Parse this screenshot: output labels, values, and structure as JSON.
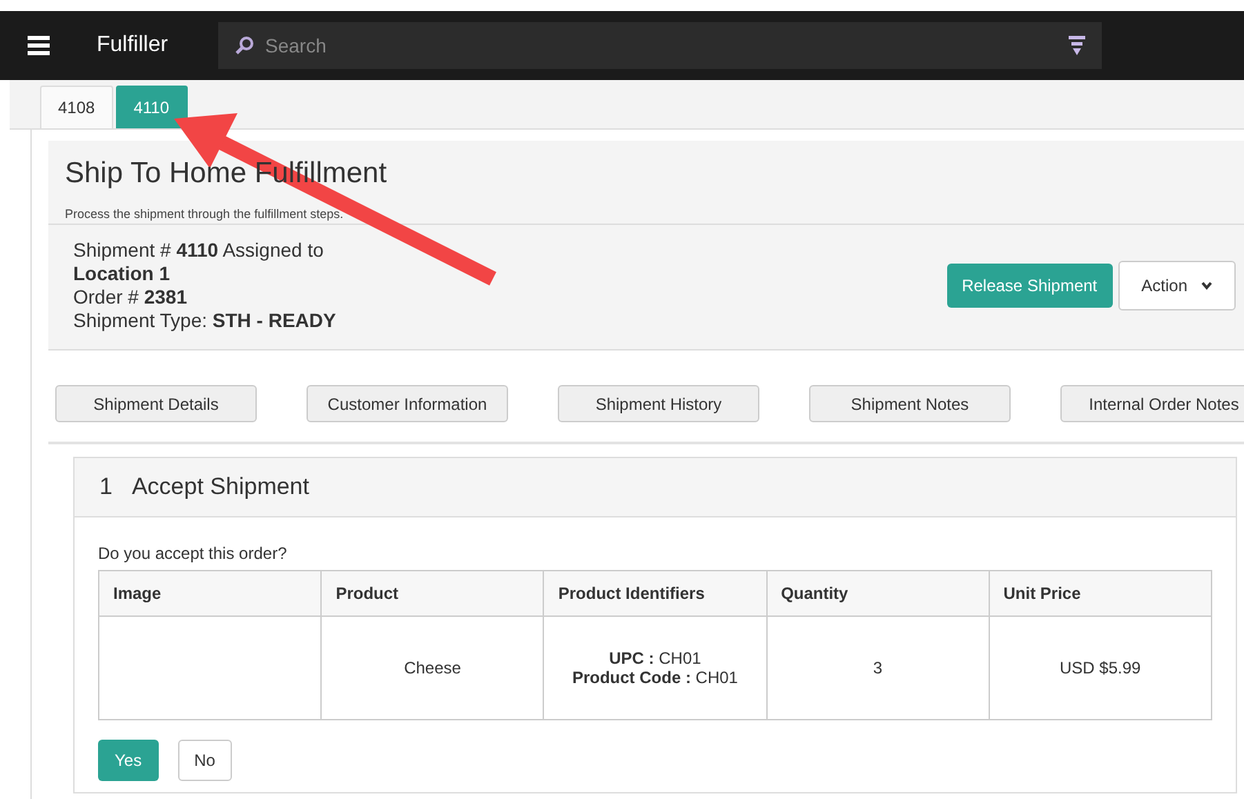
{
  "app_bar": {
    "title": "Fulfiller",
    "search": {
      "placeholder": "Search"
    }
  },
  "tabs": [
    {
      "label": "4108",
      "selected": false
    },
    {
      "label": "4110",
      "selected": true
    }
  ],
  "page": {
    "title": "Ship To Home Fulfillment",
    "subtitle": "Process the shipment through the fulfillment steps."
  },
  "shipment": {
    "line_1": "Shipment # **4110** Assigned to",
    "line_2": "**Location 1**",
    "line_3": "Order # **2381**",
    "line_4": "Shipment Type: **STH - READY**",
    "buttons": [
      {
        "label": "Release Shipment",
        "kind": "primary"
      },
      {
        "label": "Action",
        "kind": "dropdown"
      }
    ]
  },
  "section_buttons": [
    "Shipment Details",
    "Customer Information",
    "Shipment History",
    "Shipment Notes",
    "Internal Order Notes"
  ],
  "step": {
    "number": "1",
    "title": "Accept Shipment",
    "question": "Do you accept this order?",
    "table": {
      "columns": [
        "Image",
        "Product",
        "Product Identifiers",
        "Quantity",
        "Unit Price"
      ],
      "rows": [
        {
          "image": "",
          "product": "Cheese",
          "identifiers": [
            "**UPC :** CH01",
            "**Product Code :** CH01"
          ],
          "quantity": "3",
          "unit_price": "USD $5.99"
        }
      ]
    },
    "buttons": [
      {
        "label": "Yes",
        "kind": "primary"
      },
      {
        "label": "No",
        "kind": "default"
      }
    ]
  },
  "annotation": {
    "kind": "arrow"
  }
}
